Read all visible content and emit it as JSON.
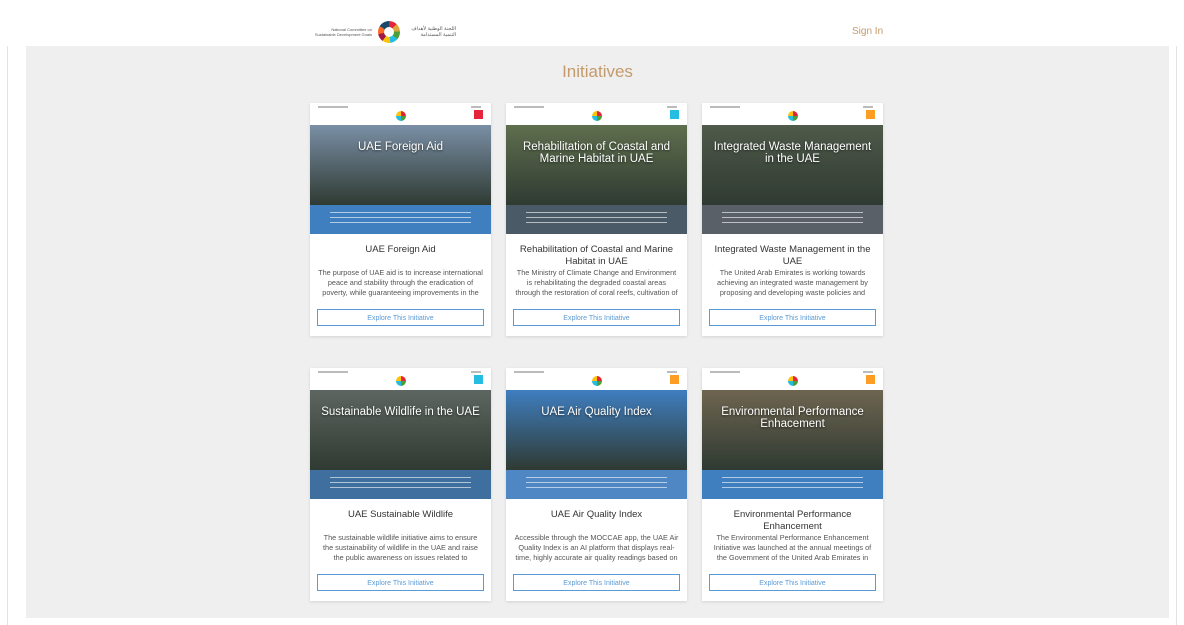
{
  "header": {
    "logo_text_en": "National Committee on Sustainable Development Goals",
    "logo_text_ar": "اللجنة الوطنية لأهداف التنمية المستدامة",
    "signin_label": "Sign In"
  },
  "page": {
    "title": "Initiatives"
  },
  "cards": [
    {
      "thumb_title": "UAE Foreign Aid",
      "name": "UAE Foreign Aid",
      "desc": "The purpose of UAE aid is to increase international peace and stability through the eradication of poverty, while guaranteeing improvements in the",
      "button": "Explore This Initiative",
      "img_color": "#7a8fa6",
      "foot_color": "#3f7fbf",
      "sdg_color": "#e5243b"
    },
    {
      "thumb_title": "Rehabilitation of Coastal and Marine Habitat in UAE",
      "name": "Rehabilitation of Coastal and Marine Habitat in UAE",
      "desc": "The Ministry of Climate Change and Environment is rehabilitating the degraded coastal areas through the restoration of coral reefs, cultivation of",
      "button": "Explore This Initiative",
      "img_color": "#5f6f4e",
      "foot_color": "#4a5a66",
      "sdg_color": "#26bde2"
    },
    {
      "thumb_title": "Integrated Waste Management in the UAE",
      "name": "Integrated Waste Management in the UAE",
      "desc": "The United Arab Emirates is working towards achieving an integrated waste management by proposing and developing waste policies and",
      "button": "Explore This Initiative",
      "img_color": "#4f5a4a",
      "foot_color": "#5a6068",
      "sdg_color": "#fd9d24"
    },
    {
      "thumb_title": "Sustainable Wildlife in the UAE",
      "name": "UAE Sustainable Wildlife",
      "desc": "The sustainable wildlife initiative aims to ensure the sustainability of wildlife in the UAE and raise the public awareness on issues related to biodiversity.",
      "button": "Explore This Initiative",
      "img_color": "#5d6660",
      "foot_color": "#3f6f9f",
      "sdg_color": "#26bde2"
    },
    {
      "thumb_title": "UAE Air Quality Index",
      "name": "UAE Air Quality Index",
      "desc": "Accessible through the MOCCAE app, the UAE Air Quality Index is an AI platform that displays real-time, highly accurate air quality readings based on",
      "button": "Explore This Initiative",
      "img_color": "#3f7ec0",
      "foot_color": "#4f86c4",
      "sdg_color": "#fd9d24"
    },
    {
      "thumb_title": "Environmental Performance Enhacement",
      "name": "Environmental Performance Enhancement",
      "desc": "The Environmental Performance Enhancement Initiative was launched at the annual meetings of the Government of the United Arab Emirates in",
      "button": "Explore This Initiative",
      "img_color": "#6e6550",
      "foot_color": "#3f7fbf",
      "sdg_color": "#fd9d24"
    }
  ]
}
